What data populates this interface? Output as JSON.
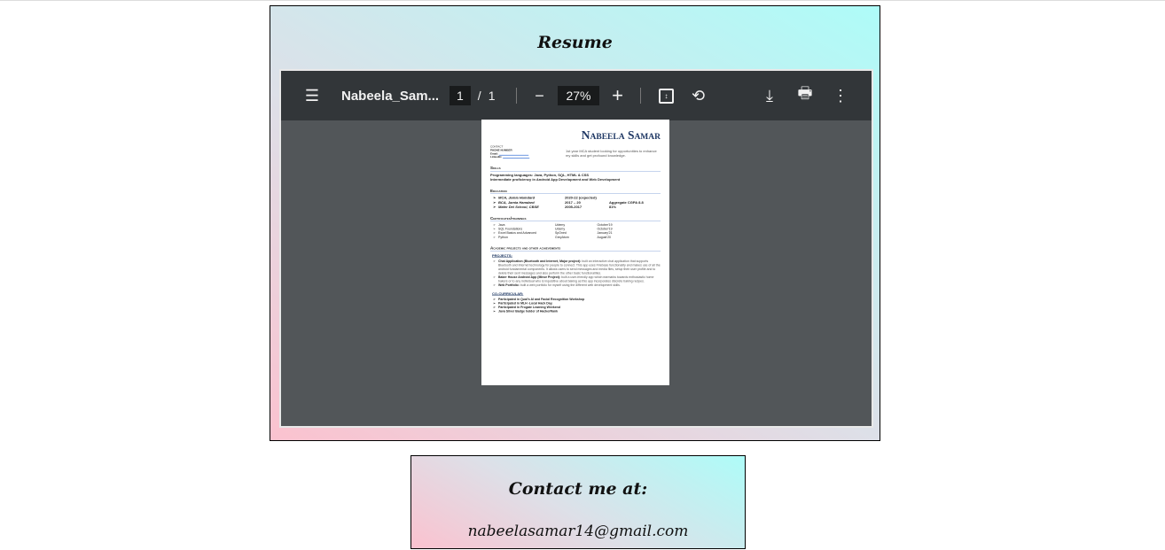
{
  "resume_title": "Resume",
  "viewer": {
    "file_name": "Nabeela_Sam...",
    "page_current": "1",
    "page_sep": "/",
    "page_total": "1",
    "zoom": "27%"
  },
  "pdf": {
    "name": "Nabeela Samar",
    "contact_label": "CONTACT",
    "phone": "PHONE NUMBER",
    "email_label": "Email:",
    "linkedin_label": "LinkedIn:",
    "objective": "1st year MCA student looking for opportunities to enhance my skills and get profound knowledge.",
    "skills_h": "Skills",
    "skills": [
      "Programming languages: Java, Python, SQL, HTML & CSS",
      "Intermediate proficiency in Android App Development and Web Development"
    ],
    "education_h": "Education",
    "education": [
      [
        "MCA, Jamia Hamdard",
        "2020-22 (expected)",
        ""
      ],
      [
        "BCA, Jamia Hamdard",
        "2017 – 20",
        "Aggregate CGPA 8.8"
      ],
      [
        "Mater Dei School, CBSE",
        "2005-2017",
        "81%"
      ]
    ],
    "cert_h": "Certificates/trainings",
    "certs": [
      [
        "Java",
        "Udemy",
        "October'19"
      ],
      [
        "SQL Foundations",
        "Udemy",
        "October'19"
      ],
      [
        "Excel Basics and Advanced",
        "SpOned",
        "January'21"
      ],
      [
        "Python",
        "GreyAtom",
        "August'20"
      ]
    ],
    "academic_h": "Academic projects and other achievements",
    "projects_h": "PROJECTS:",
    "projects": [
      [
        "Chat Application (Bluetooth and Internet, Major project):",
        "built an interactive chat application that supports Bluetooth and Internet technology for people to connect. This app uses Firebase functionality and makes use of all the android fundamental components. It allows users to send messages and media files, setup their user profile and to delete their sent messages and also perform the other basic functionalities."
      ],
      [
        "Baker House Android App (Minor Project):",
        "built a user-friendly app which earmarks towards enthusiastic home bakers or to any individual who is inquisitive about baking as this app incorporates discrete baking recipes."
      ],
      [
        "Web Portfolio:",
        "built a web portfolio for myself using the different web development skills."
      ]
    ],
    "cocurr_h": "CO-CURRICULAR:",
    "cocurr": [
      "Participated in Qual's AI and Facial Recognition Workshop",
      "Participated in MLH -Local Hack Day.",
      "Participated in Frogate Learning Weekend",
      "Java Silver Badge holder of HackerRank"
    ]
  },
  "contact": {
    "title": "Contact me at:",
    "email": "nabeelasamar14@gmail.com"
  }
}
